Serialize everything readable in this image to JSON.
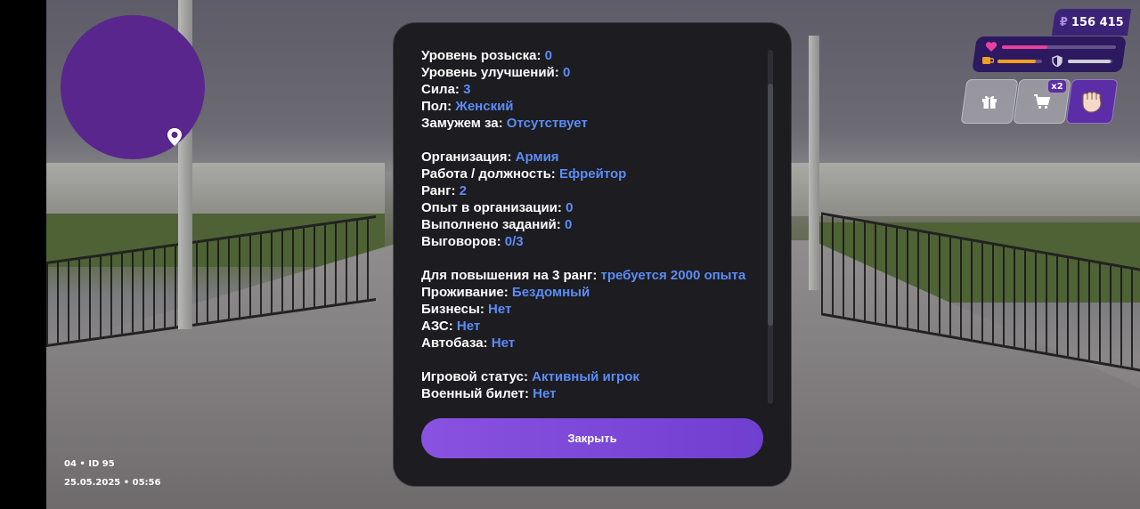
{
  "hud": {
    "money": "156 415",
    "currency_symbol": "₽",
    "health_level": 0.4,
    "food_level": 0.85,
    "armor_level": 0.95,
    "shop_badge": "x2",
    "accent_color": "#5b2ea8"
  },
  "session": {
    "server_id": "04 • ID 95",
    "datetime": "25.05.2025 • 05:56"
  },
  "dialog": {
    "rows": [
      {
        "label": "Уровень розыска:",
        "value": "0"
      },
      {
        "label": "Уровень улучшений:",
        "value": "0"
      },
      {
        "label": "Сила:",
        "value": "3"
      },
      {
        "label": "Пол:",
        "value": "Женский"
      },
      {
        "label": "Замужем за:",
        "value": "Отсутствует"
      },
      {
        "label": "",
        "value": ""
      },
      {
        "label": "Организация:",
        "value": "Армия"
      },
      {
        "label": "Работа / должность:",
        "value": "Ефрейтор"
      },
      {
        "label": "Ранг:",
        "value": "2"
      },
      {
        "label": "Опыт в организации:",
        "value": "0"
      },
      {
        "label": "Выполнено заданий:",
        "value": "0"
      },
      {
        "label": "Выговоров:",
        "value": "0/3"
      },
      {
        "label": "",
        "value": ""
      },
      {
        "label": "Для повышения на 3 ранг:",
        "value": "требуется 2000 опыта"
      },
      {
        "label": "Проживание:",
        "value": "Бездомный"
      },
      {
        "label": "Бизнесы:",
        "value": "Нет"
      },
      {
        "label": "АЗС:",
        "value": "Нет"
      },
      {
        "label": "Автобаза:",
        "value": "Нет"
      },
      {
        "label": "",
        "value": ""
      },
      {
        "label": "Игровой статус:",
        "value": "Активный игрок"
      },
      {
        "label": "Военный билет:",
        "value": "Нет"
      }
    ],
    "close_label": "Закрыть",
    "scroll_position": 0.3,
    "value_color": "#5c8cf5"
  }
}
